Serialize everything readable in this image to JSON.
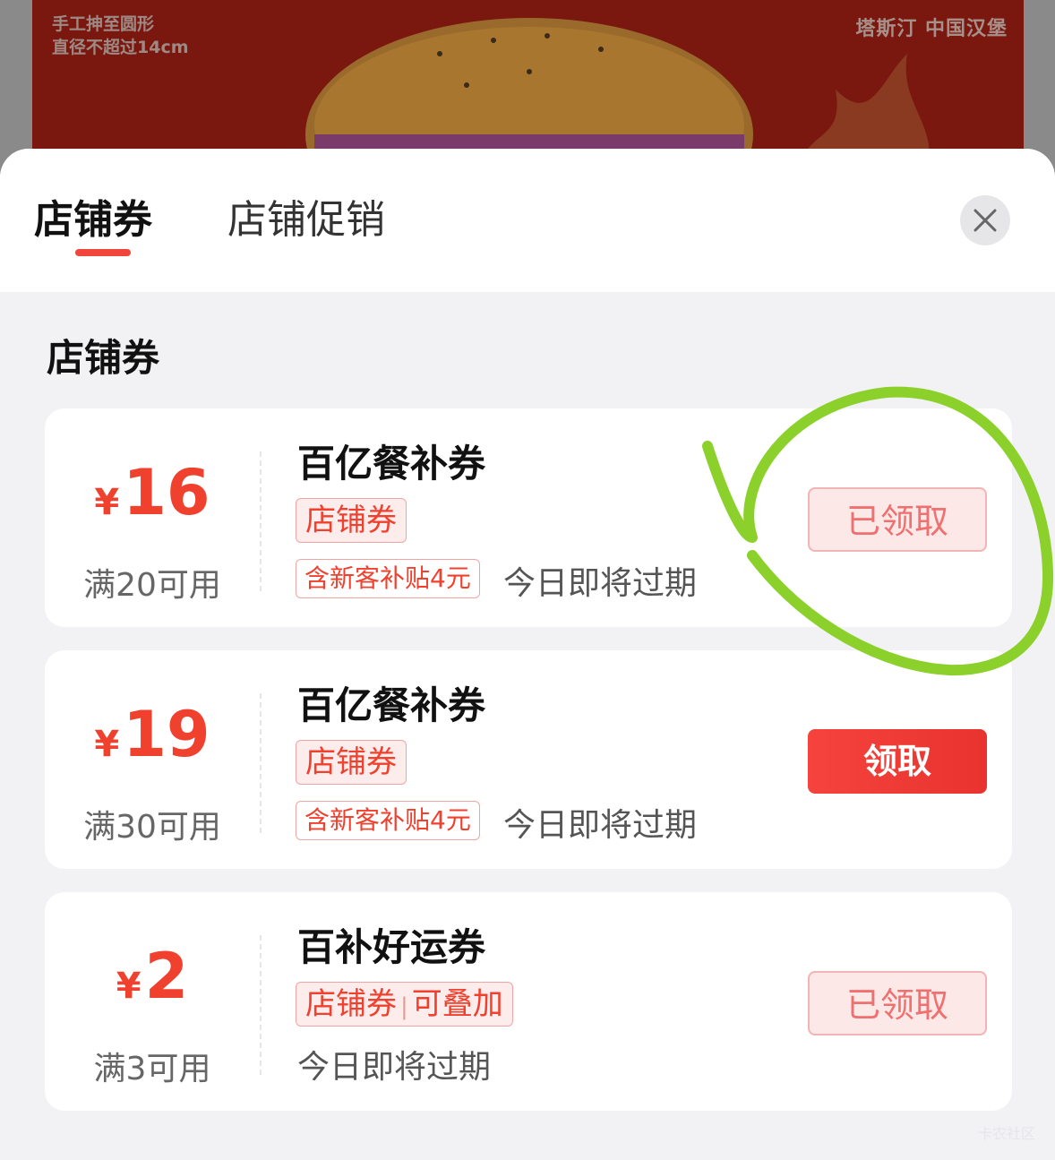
{
  "banner": {
    "line1": "手工抻至圆形",
    "line2": "直径不超过14cm",
    "brand": "塔斯汀 中国汉堡"
  },
  "tabs": [
    {
      "label": "店铺券",
      "active": true
    },
    {
      "label": "店铺促销",
      "active": false
    }
  ],
  "close_icon": "close-icon",
  "section_title": "店铺券",
  "coupons": [
    {
      "currency": "¥",
      "amount": "16",
      "condition": "满20可用",
      "title": "百亿餐补券",
      "tag": "店铺券",
      "subsidy": "含新客补贴4元",
      "expire": "今日即将过期",
      "button": "已领取",
      "button_state": "claimed"
    },
    {
      "currency": "¥",
      "amount": "19",
      "condition": "满30可用",
      "title": "百亿餐补券",
      "tag": "店铺券",
      "subsidy": "含新客补贴4元",
      "expire": "今日即将过期",
      "button": "领取",
      "button_state": "available"
    },
    {
      "currency": "¥",
      "amount": "2",
      "condition": "满3可用",
      "title": "百补好运券",
      "tag": "店铺券",
      "tag_extra": "可叠加",
      "expire": "今日即将过期",
      "button": "已领取",
      "button_state": "claimed"
    }
  ],
  "watermark": "卡农社区",
  "colors": {
    "accent": "#f0402e",
    "annotation": "#8cd12b"
  }
}
